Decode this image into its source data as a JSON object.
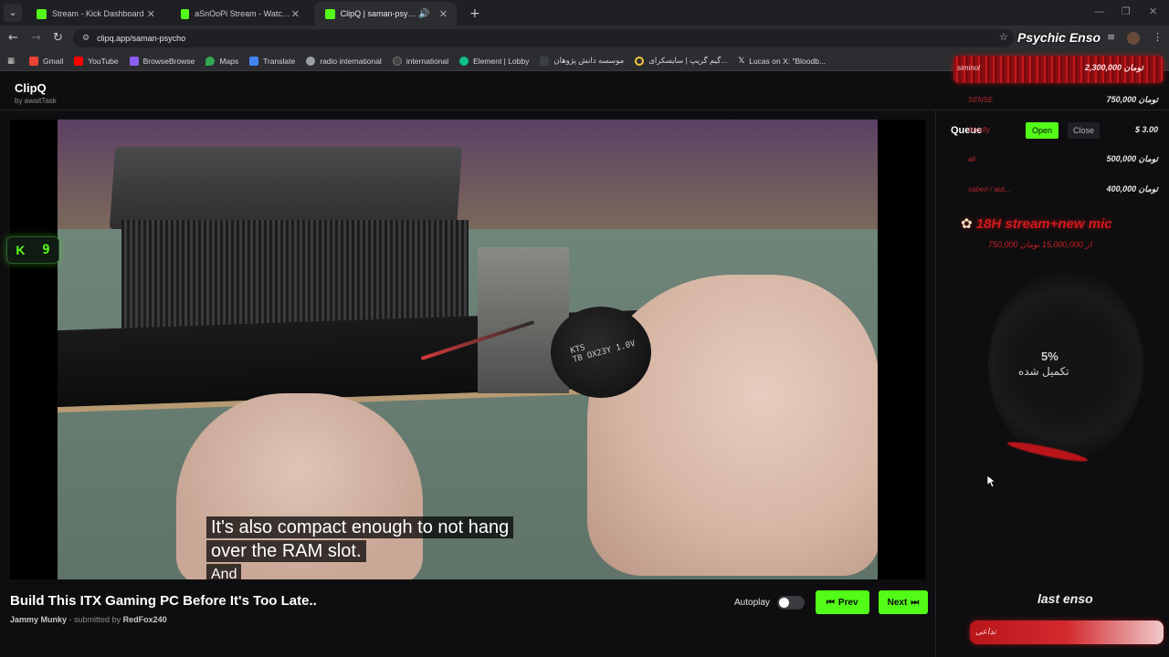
{
  "browser": {
    "tabs": [
      {
        "title": "Stream - Kick Dashboard",
        "favicon_color": "#53fc18",
        "active": false
      },
      {
        "title": "aSnOoPi Stream - Watch Live o",
        "favicon_color": "#53fc18",
        "active": false
      },
      {
        "title": "ClipQ | saman-psycho",
        "favicon_color": "#53fc18",
        "active": true
      }
    ],
    "url": "clipq.app/saman-psycho",
    "bookmarks": [
      {
        "label": "Gmail",
        "color": "#ea4335"
      },
      {
        "label": "YouTube",
        "color": "#ff0000"
      },
      {
        "label": "BrowseBrowse",
        "color": "#8e5cf7"
      },
      {
        "label": "Maps",
        "color": "#34a853"
      },
      {
        "label": "Translate",
        "color": "#4285f4"
      },
      {
        "label": "radio international",
        "color": "#9aa0a6"
      },
      {
        "label": "international",
        "color": "#444444"
      },
      {
        "label": "Element | Lobby",
        "color": "#0dbd8b"
      },
      {
        "label": "موسسه دانش پژوهان",
        "color": "#3c4043"
      },
      {
        "label": "گیم گریپ | سایسکرای...",
        "color": "#f2c744"
      },
      {
        "label": "Lucas on X: \"Bloodb...",
        "color": "#e8e8e8"
      }
    ]
  },
  "overlay": {
    "name": "Psychic Enso",
    "top_donor": {
      "name": "siminol",
      "amount": "2,300,000 تومان"
    },
    "donors": [
      {
        "name": "SENSE",
        "amount": "750,000 تومان"
      },
      {
        "name": "Arcxfiy",
        "amount": "$ 3.00"
      },
      {
        "name": "ali",
        "amount": "500,000 تومان"
      },
      {
        "name": "saberi / aut...",
        "amount": "400,000 تومان"
      }
    ],
    "goal": {
      "title": "18H stream+new mic",
      "subtitle": "750,000 از 15,000,000 تومان",
      "percent": "5%",
      "percent_label": "تکمیل شده",
      "progress": 0.05
    },
    "last": {
      "title": "last enso",
      "name": "تداعی"
    }
  },
  "app": {
    "brand": "ClipQ",
    "brand_sub": "by awaitTask",
    "kick_badge": {
      "icon": "K",
      "count": "9"
    },
    "video": {
      "subtitle_line1": "It's also compact enough to not hang",
      "subtitle_line2": "over the RAM slot.",
      "subtitle_line3": "And",
      "component_label": "KTS\nTB OX23Y 1.0V"
    },
    "info": {
      "title": "Build This ITX Gaming PC Before It's Too Late..",
      "channel": "Jammy Munky",
      "submitted_prefix": "- submitted by",
      "submitter": "RedFox240"
    },
    "controls": {
      "autoplay_label": "Autoplay",
      "autoplay_on": false,
      "prev_label": "Prev",
      "next_label": "Next"
    },
    "queue": {
      "title": "Queue",
      "open_label": "Open",
      "close_label": "Close"
    }
  },
  "colors": {
    "accent": "#53fc18",
    "overlay_red": "#d2191c"
  }
}
